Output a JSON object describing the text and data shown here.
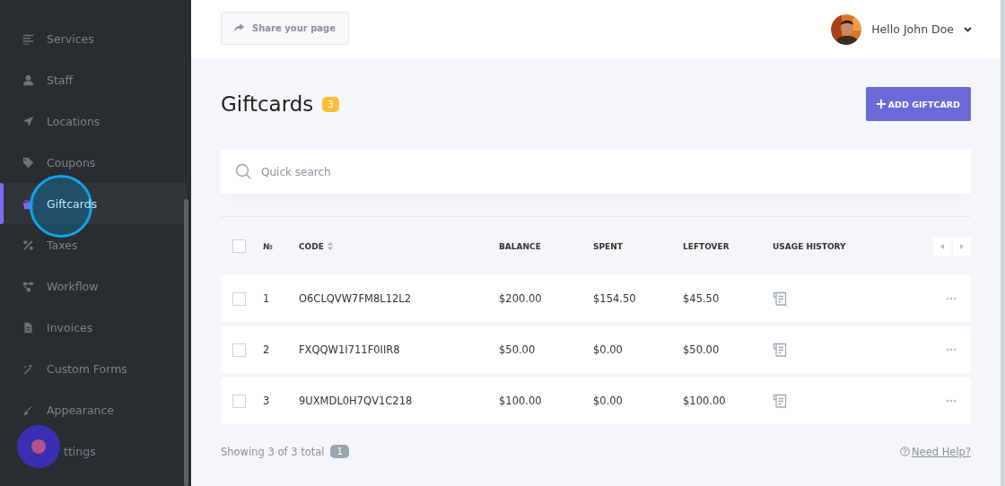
{
  "sidebar": {
    "items": [
      {
        "label": "Services",
        "selected": false
      },
      {
        "label": "Staff",
        "selected": false
      },
      {
        "label": "Locations",
        "selected": false
      },
      {
        "label": "Coupons",
        "selected": false
      },
      {
        "label": "Giftcards",
        "selected": true
      },
      {
        "label": "Taxes",
        "selected": false
      },
      {
        "label": "Workflow",
        "selected": false
      },
      {
        "label": "Invoices",
        "selected": false
      },
      {
        "label": "Custom Forms",
        "selected": false
      },
      {
        "label": "Appearance",
        "selected": false
      },
      {
        "label": "ttings",
        "selected": false
      }
    ]
  },
  "header": {
    "share_button": "Share your page",
    "user": {
      "greeting": "Hello John Doe"
    }
  },
  "page": {
    "title": "Giftcards",
    "count": "3",
    "add_button": "ADD GIFTCARD"
  },
  "search": {
    "placeholder": "Quick search"
  },
  "table": {
    "select_all": {
      "checked": false
    },
    "columns": [
      "№",
      "CODE",
      "BALANCE",
      "SPENT",
      "LEFTOVER",
      "USAGE HISTORY"
    ],
    "rows": [
      {
        "checked": false,
        "number": "1",
        "code": "O6CLQVW7FM8L12L2",
        "balance": "$200.00",
        "spent": "$154.50",
        "leftover": "$45.50"
      },
      {
        "checked": false,
        "number": "2",
        "code": "FXQQW1I711F0IIR8",
        "balance": "$50.00",
        "spent": "$0.00",
        "leftover": "$50.00"
      },
      {
        "checked": false,
        "number": "3",
        "code": "9UXMDL0H7QV1C218",
        "balance": "$100.00",
        "spent": "$0.00",
        "leftover": "$100.00"
      }
    ]
  },
  "footer": {
    "summary": "Showing 3 of 3 total",
    "page": "1",
    "help_link": "Need Help?"
  }
}
